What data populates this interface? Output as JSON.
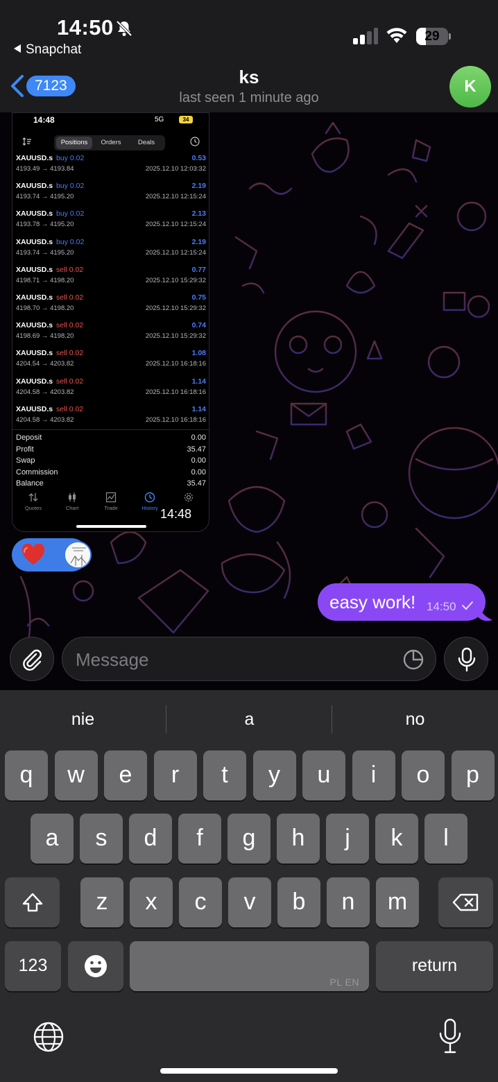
{
  "status_bar": {
    "time": "14:50",
    "back_app": "Snapchat",
    "battery": "29"
  },
  "header": {
    "unread_count": "7123",
    "contact_name": "ks",
    "last_seen": "last seen 1 minute ago",
    "avatar_initial": "K"
  },
  "shared_screenshot": {
    "status_time": "14:48",
    "network": "5G",
    "battery": "34",
    "tabs": [
      "Positions",
      "Orders",
      "Deals"
    ],
    "active_tab": "Positions",
    "positions": [
      {
        "symbol": "XAUUSD.s",
        "side": "buy 0.02",
        "type": "buy",
        "profit": "0.53",
        "prices": "4193.49 → 4193.84",
        "date": "2025.12.10 12:03:32"
      },
      {
        "symbol": "XAUUSD.s",
        "side": "buy 0.02",
        "type": "buy",
        "profit": "2.19",
        "prices": "4193.74 → 4195.20",
        "date": "2025.12.10 12:15:24"
      },
      {
        "symbol": "XAUUSD.s",
        "side": "buy 0.02",
        "type": "buy",
        "profit": "2.13",
        "prices": "4193.78 → 4195.20",
        "date": "2025.12.10 12:15:24"
      },
      {
        "symbol": "XAUUSD.s",
        "side": "buy 0.02",
        "type": "buy",
        "profit": "2.19",
        "prices": "4193.74 → 4195.20",
        "date": "2025.12.10 12:15:24"
      },
      {
        "symbol": "XAUUSD.s",
        "side": "sell 0.02",
        "type": "sell",
        "profit": "0.77",
        "prices": "4198.71 → 4198.20",
        "date": "2025.12.10 15:29:32"
      },
      {
        "symbol": "XAUUSD.s",
        "side": "sell 0.02",
        "type": "sell",
        "profit": "0.75",
        "prices": "4198.70 → 4198.20",
        "date": "2025.12.10 15:29:32"
      },
      {
        "symbol": "XAUUSD.s",
        "side": "sell 0.02",
        "type": "sell",
        "profit": "0.74",
        "prices": "4198.69 → 4198.20",
        "date": "2025.12.10 15:29:32"
      },
      {
        "symbol": "XAUUSD.s",
        "side": "sell 0.02",
        "type": "sell",
        "profit": "1.08",
        "prices": "4204.54 → 4203.82",
        "date": "2025.12.10 16:18:16"
      },
      {
        "symbol": "XAUUSD.s",
        "side": "sell 0.02",
        "type": "sell",
        "profit": "1.14",
        "prices": "4204.58 → 4203.82",
        "date": "2025.12.10 16:18:16"
      },
      {
        "symbol": "XAUUSD.s",
        "side": "sell 0.02",
        "type": "sell",
        "profit": "1.14",
        "prices": "4204.58 → 4203.82",
        "date": "2025.12.10 16:18:16"
      }
    ],
    "summary": [
      {
        "label": "Deposit",
        "value": "0.00"
      },
      {
        "label": "Profit",
        "value": "35.47"
      },
      {
        "label": "Swap",
        "value": "0.00"
      },
      {
        "label": "Commission",
        "value": "0.00"
      },
      {
        "label": "Balance",
        "value": "35.47"
      }
    ],
    "bottom_tabs": [
      {
        "label": "Quotes",
        "icon": "quotes-arrows-icon"
      },
      {
        "label": "Chart",
        "icon": "candles-icon"
      },
      {
        "label": "Trade",
        "icon": "trade-chart-icon"
      },
      {
        "label": "History",
        "icon": "history-clock-icon"
      },
      {
        "label": "Settings",
        "icon": "gear-icon"
      }
    ],
    "active_bottom_tab": "History",
    "message_time": "14:48"
  },
  "reaction": {
    "emoji": "heart",
    "emoji_color": "#e0302e"
  },
  "outgoing_message": {
    "text": "easy work!",
    "time": "14:50"
  },
  "composer": {
    "placeholder": "Message"
  },
  "keyboard": {
    "suggestions": [
      "nie",
      "a",
      "no"
    ],
    "row1": [
      "q",
      "w",
      "e",
      "r",
      "t",
      "y",
      "u",
      "i",
      "o",
      "p"
    ],
    "row2": [
      "a",
      "s",
      "d",
      "f",
      "g",
      "h",
      "j",
      "k",
      "l"
    ],
    "row3": [
      "z",
      "x",
      "c",
      "v",
      "b",
      "n",
      "m"
    ],
    "numbers_label": "123",
    "return_label": "return",
    "languages": "PL EN"
  },
  "colors": {
    "accent_blue": "#3e88f7",
    "outgoing_bubble": "#8a48f5",
    "avatar_green": "#5bc250",
    "buy_blue": "#4a7cff",
    "sell_red": "#f0524e"
  }
}
